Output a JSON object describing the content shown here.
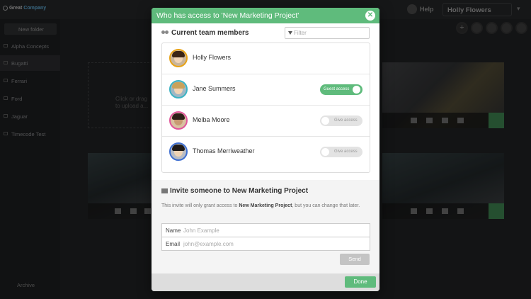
{
  "app": {
    "logo_text_a": "Great ",
    "logo_text_b": "Company",
    "help": "Help",
    "user": "Holly Flowers",
    "new_folder": "New folder",
    "archive": "Archive",
    "upload_text_a": "Click or drag",
    "upload_text_b": "to upload a..."
  },
  "sidebar": {
    "items": [
      {
        "label": "Alpha Concepts"
      },
      {
        "label": "Bugatti"
      },
      {
        "label": "Ferrari"
      },
      {
        "label": "Ford"
      },
      {
        "label": "Jaguar"
      },
      {
        "label": "Timecode Test"
      }
    ]
  },
  "modal": {
    "title": "Who has access to 'New Marketing Project'",
    "close": "✕",
    "members_title": "Current team members",
    "filter_placeholder": "Filter",
    "members": [
      {
        "name": "Holly Flowers",
        "ring": "#e8a317"
      },
      {
        "name": "Jane Summers",
        "ring": "#3bb3c3",
        "toggle": "Guest access",
        "on": true
      },
      {
        "name": "Melba Moore",
        "ring": "#e0559a",
        "toggle": "Give access",
        "on": false
      },
      {
        "name": "Thomas Merriweather",
        "ring": "#3f6fd1",
        "toggle": "Give access",
        "on": false
      }
    ],
    "invite_title": "Invite someone to New Marketing Project",
    "invite_desc_a": "This invite will only grant access to ",
    "invite_desc_b": "New Marketing Project",
    "invite_desc_c": ", but you can change that later.",
    "name_label": "Name",
    "name_placeholder": "John Example",
    "email_label": "Email",
    "email_placeholder": "john@example.com",
    "send": "Send",
    "done": "Done"
  }
}
